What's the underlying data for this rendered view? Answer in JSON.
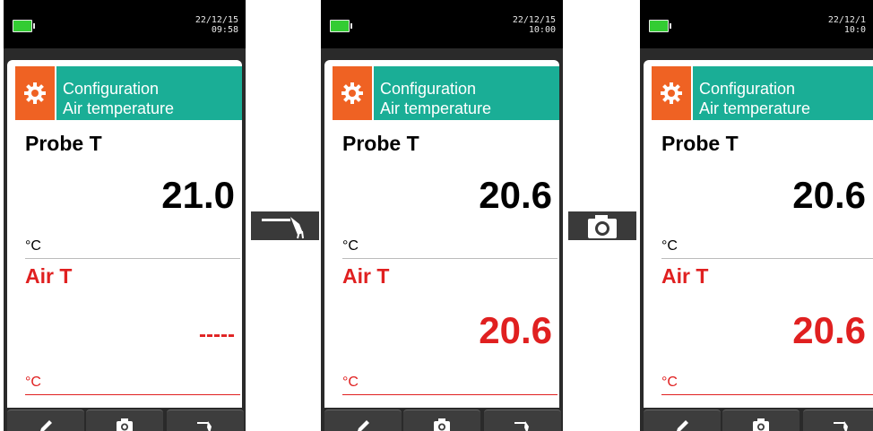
{
  "screens": [
    {
      "date": "22/12/15",
      "time": "09:58",
      "header": {
        "line1": "Configuration",
        "line2": "Air temperature"
      },
      "probe": {
        "name": "Probe T",
        "value": "21.0",
        "unit": "°C"
      },
      "air": {
        "name": "Air T",
        "value": "-----",
        "unit": "°C"
      }
    },
    {
      "date": "22/12/15",
      "time": "10:00",
      "header": {
        "line1": "Configuration",
        "line2": "Air temperature"
      },
      "probe": {
        "name": "Probe T",
        "value": "20.6",
        "unit": "°C"
      },
      "air": {
        "name": "Air T",
        "value": "20.6",
        "unit": "°C"
      }
    },
    {
      "date": "22/12/1",
      "time": "10:0",
      "header": {
        "line1": "Configuration",
        "line2": "Air temperature"
      },
      "probe": {
        "name": "Probe T",
        "value": "20.6",
        "unit": "°C"
      },
      "air": {
        "name": "Air T",
        "value": "20.6",
        "unit": "°C"
      }
    }
  ],
  "softkeys": [
    "pencil-icon",
    "camera-icon",
    "probe-icon"
  ],
  "transitions": [
    "probe-icon",
    "camera-icon"
  ],
  "colors": {
    "accent_teal": "#1aae96",
    "accent_orange": "#ef6223",
    "value_red": "#e02020",
    "battery_green": "#33cc33"
  }
}
